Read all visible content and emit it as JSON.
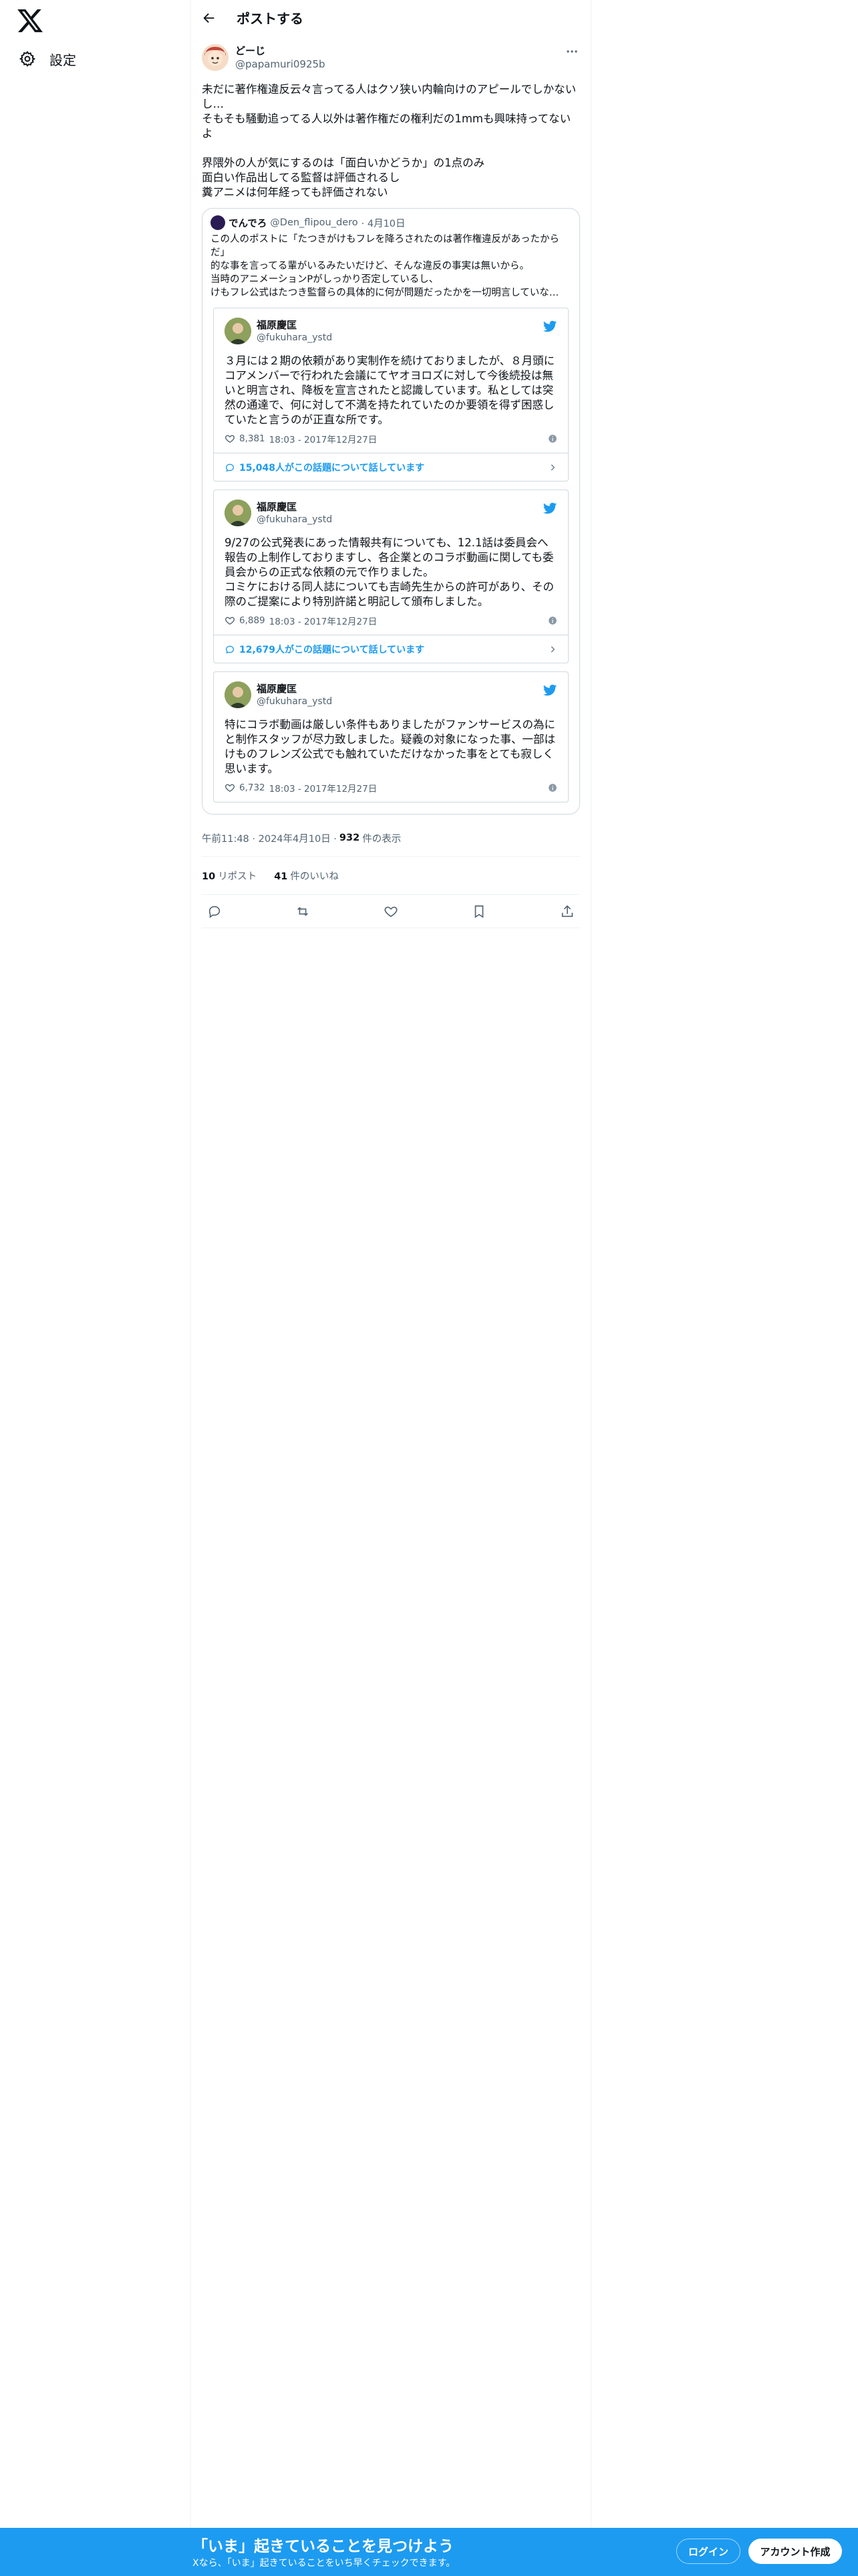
{
  "sidebar": {
    "logo_icon": "x-logo-icon",
    "settings_label": "設定"
  },
  "header": {
    "title": "ポストする"
  },
  "post": {
    "author_name": "どーじ",
    "author_handle": "@papamuri0925b",
    "text": "未だに著作権違反云々言ってる人はクソ狭い内輪向けのアピールでしかないし…\nそもそも騒動追ってる人以外は著作権だの権利だの1mmも興味持ってないよ\n\n界隈外の人が気にするのは「面白いかどうか」の1点のみ\n面白い作品出してる監督は評価されるし\n糞アニメは何年経っても評価されない",
    "quote": {
      "author_name": "でんでろ",
      "author_handle": "@Den_flipou_dero",
      "date": "· 4月10日",
      "text": "この人のポストに「たつきがけもフレを降ろされたのは著作権違反があったからだ」\n的な事を言ってる輩がいるみたいだけど、そんな違反の事実は無いから。\n当時のアニメーションPがしっかり否定しているし、\nけもフレ公式はたつき監督らの具体的に何が問題だったかを一切明言していな…",
      "embeds": [
        {
          "name": "福原慶匡",
          "handle": "@fukuhara_ystd",
          "text": "３月には２期の依頼があり実制作を続けておりましたが、８月頭にコアメンバーで行われた会議にてヤオヨロズに対して今後続投は無いと明言され、降板を宣言されたと認識しています。私としては突然の通達で、何に対して不満を持たれていたのか要領を得ず困惑していたと言うのが正直な所です。",
          "likes": "8,381",
          "time": "18:03 - 2017年12月27日",
          "talk": "15,048人がこの話題について話しています"
        },
        {
          "name": "福原慶匡",
          "handle": "@fukuhara_ystd",
          "text": "9/27の公式発表にあった情報共有についても、12.1話は委員会へ報告の上制作しておりますし、各企業とのコラボ動画に関しても委員会からの正式な依頼の元で作りました。\nコミケにおける同人誌についても吉崎先生からの許可があり、その際のご提案により特別許諾と明記して頒布しました。",
          "likes": "6,889",
          "time": "18:03 - 2017年12月27日",
          "talk": "12,679人がこの話題について話しています"
        },
        {
          "name": "福原慶匡",
          "handle": "@fukuhara_ystd",
          "text": "特にコラボ動画は厳しい条件もありましたがファンサービスの為にと制作スタッフが尽力致しました。疑義の対象になった事、一部はけものフレンズ公式でも触れていただけなかった事をとても寂しく思います。",
          "likes": "6,732",
          "time": "18:03 - 2017年12月27日"
        }
      ]
    },
    "timestamp": "午前11:48 · 2024年4月10日 · ",
    "views_count": "932",
    "views_label": "件の表示",
    "reposts_count": "10",
    "reposts_label": "リポスト",
    "likes_count": "41",
    "likes_label": "件のいいね"
  },
  "banner": {
    "title": "「いま」起きていることを見つけよう",
    "subtitle": "Xなら、「いま」起きていることをいち早くチェックできます。",
    "login_label": "ログイン",
    "signup_label": "アカウント作成"
  },
  "colors": {
    "accent": "#1d9bf0",
    "text": "#0f1419",
    "muted": "#536471",
    "border": "#cfd9de"
  }
}
